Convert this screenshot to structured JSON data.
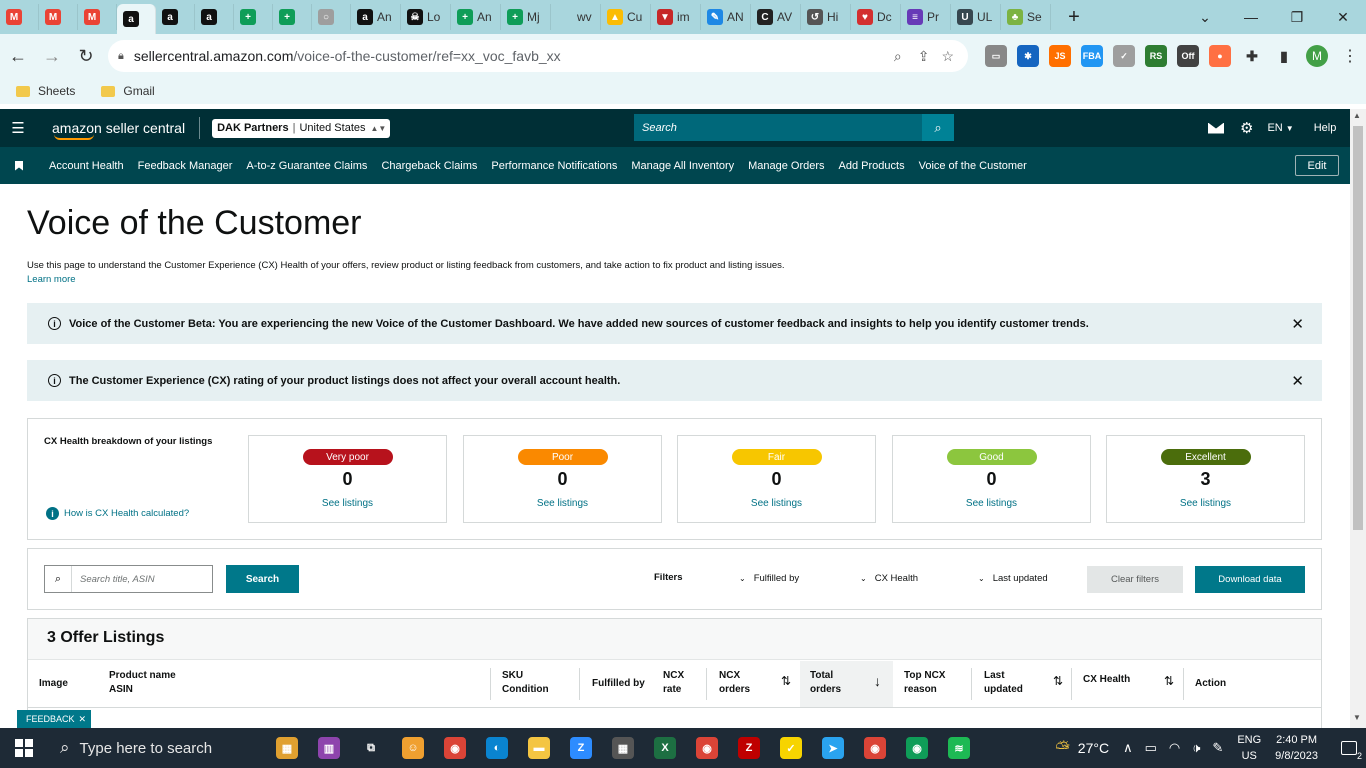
{
  "browser": {
    "tabs": [
      {
        "icon": "gmail-icon",
        "label": "",
        "color": "#ea4335",
        "glyph": "M"
      },
      {
        "icon": "gmail-icon",
        "label": "",
        "color": "#ea4335",
        "glyph": "M"
      },
      {
        "icon": "gmail-icon",
        "label": "",
        "color": "#ea4335",
        "glyph": "M"
      },
      {
        "icon": "amazon-icon",
        "label": "",
        "color": "#111111",
        "glyph": "a",
        "active": true
      },
      {
        "icon": "amazon-icon",
        "label": "",
        "color": "#111111",
        "glyph": "a"
      },
      {
        "icon": "amazon-icon",
        "label": "",
        "color": "#111111",
        "glyph": "a"
      },
      {
        "icon": "sheets-icon",
        "label": "",
        "color": "#0f9d58",
        "glyph": "+"
      },
      {
        "icon": "sheets-icon",
        "label": "",
        "color": "#0f9d58",
        "glyph": "+"
      },
      {
        "icon": "loading-icon",
        "label": "",
        "color": "#9e9e9e",
        "glyph": "○"
      },
      {
        "icon": "amazon-icon",
        "label": "An",
        "color": "#111111",
        "glyph": "a"
      },
      {
        "icon": "pirate-icon",
        "label": "Lo",
        "color": "#111111",
        "glyph": "☠"
      },
      {
        "icon": "sheets-icon",
        "label": "An",
        "color": "#0f9d58",
        "glyph": "+"
      },
      {
        "icon": "sheets-icon",
        "label": "Mj",
        "color": "#0f9d58",
        "glyph": "+"
      },
      {
        "icon": "blank-icon",
        "label": "wv",
        "color": "#a9d6dd",
        "glyph": ""
      },
      {
        "icon": "drive-icon",
        "label": "Cu",
        "color": "#fbbc04",
        "glyph": "▲"
      },
      {
        "icon": "filter-icon",
        "label": "im",
        "color": "#c62828",
        "glyph": "▼"
      },
      {
        "icon": "pencil-icon",
        "label": "AN",
        "color": "#1e88e5",
        "glyph": "✎"
      },
      {
        "icon": "circle-c-icon",
        "label": "AV",
        "color": "#222222",
        "glyph": "C"
      },
      {
        "icon": "history-icon",
        "label": "Hi",
        "color": "#555555",
        "glyph": "↺"
      },
      {
        "icon": "heart-icon",
        "label": "Dc",
        "color": "#d32f2f",
        "glyph": "♥"
      },
      {
        "icon": "forms-icon",
        "label": "Pr",
        "color": "#673ab7",
        "glyph": "≡"
      },
      {
        "icon": "uline-icon",
        "label": "UL",
        "color": "#37474f",
        "glyph": "U"
      },
      {
        "icon": "leaf-icon",
        "label": "Se",
        "color": "#7cb342",
        "glyph": "♣"
      }
    ],
    "url_host": "sellercentral.amazon.com",
    "url_path": "/voice-of-the-customer/ref=xx_voc_favb_xx",
    "extensions": [
      {
        "icon": "ext-sales-icon",
        "color": "#888888",
        "glyph": "▭"
      },
      {
        "icon": "ext-gear-icon",
        "color": "#1565c0",
        "glyph": "✱"
      },
      {
        "icon": "ext-js-icon",
        "color": "#ff6f00",
        "glyph": "JS"
      },
      {
        "icon": "ext-fba-icon",
        "color": "#2196f3",
        "glyph": "FBA"
      },
      {
        "icon": "ext-check-icon",
        "color": "#9e9e9e",
        "glyph": "✓"
      },
      {
        "icon": "ext-rs-icon",
        "color": "#2e7d32",
        "glyph": "RS"
      },
      {
        "icon": "ext-off-icon",
        "color": "#424242",
        "glyph": "Off"
      },
      {
        "icon": "ext-orange-icon",
        "color": "#ff7043",
        "glyph": "●"
      },
      {
        "icon": "puzzle-icon",
        "color": "#333333",
        "glyph": "✚"
      },
      {
        "icon": "sidepanel-icon",
        "color": "#333333",
        "glyph": "▮"
      }
    ],
    "profile_initial": "M",
    "bookmarks": [
      "Sheets",
      "Gmail"
    ]
  },
  "header": {
    "logo_text": "amazon seller central",
    "account": "DAK Partners",
    "marketplace": "United States",
    "search_placeholder": "Search",
    "lang": "EN",
    "help": "Help"
  },
  "nav": {
    "items": [
      "Account Health",
      "Feedback Manager",
      "A-to-z Guarantee Claims",
      "Chargeback Claims",
      "Performance Notifications",
      "Manage All Inventory",
      "Manage Orders",
      "Add Products",
      "Voice of the Customer"
    ],
    "edit": "Edit"
  },
  "page": {
    "title": "Voice of the Customer",
    "description": "Use this page to understand the Customer Experience (CX) Health of your offers, review product or listing feedback from customers, and take action to fix product and listing issues.",
    "learn_more": "Learn more",
    "banner1": "Voice of the Customer Beta: You are experiencing the new Voice of the Customer Dashboard. We have added new sources of customer feedback and insights to help you identify customer trends.",
    "banner2": "The Customer Experience (CX) rating of your product listings does not affect your overall account health.",
    "breakdown_title": "CX Health breakdown of your listings",
    "how_calc": "How is CX Health calculated?",
    "cards": [
      {
        "label": "Very poor",
        "count": "0",
        "link": "See listings",
        "color": "#b7121c"
      },
      {
        "label": "Poor",
        "count": "0",
        "link": "See listings",
        "color": "#fa8900"
      },
      {
        "label": "Fair",
        "count": "0",
        "link": "See listings",
        "color": "#f7c600"
      },
      {
        "label": "Good",
        "count": "0",
        "link": "See listings",
        "color": "#8cc63e"
      },
      {
        "label": "Excellent",
        "count": "3",
        "link": "See listings",
        "color": "#4b6d0c"
      }
    ],
    "search_placeholder": "Search title, ASIN",
    "search_button": "Search",
    "filters_label": "Filters",
    "filter_fulfilled": "Fulfilled by",
    "filter_cx": "CX Health",
    "filter_updated": "Last updated",
    "clear_filters": "Clear filters",
    "download": "Download data",
    "listings_title": "3 Offer Listings",
    "columns": {
      "image": "Image",
      "product": "Product name",
      "asin": "ASIN",
      "sku": "SKU",
      "condition": "Condition",
      "fulfilled": "Fulfilled by",
      "ncx_rate_1": "NCX",
      "ncx_rate_2": "rate",
      "ncx_orders_1": "NCX",
      "ncx_orders_2": "orders",
      "total_1": "Total",
      "total_2": "orders",
      "top_ncx_1": "Top NCX",
      "top_ncx_2": "reason",
      "last_1": "Last",
      "last_2": "updated",
      "cx_health": "CX Health",
      "action": "Action"
    },
    "feedback_tab": "FEEDBACK"
  },
  "taskbar": {
    "search_placeholder": "Type here to search",
    "weather": "27°C",
    "lang1": "ENG",
    "lang2": "US",
    "time": "2:40 PM",
    "date": "9/8/2023",
    "notif_count": "2"
  }
}
